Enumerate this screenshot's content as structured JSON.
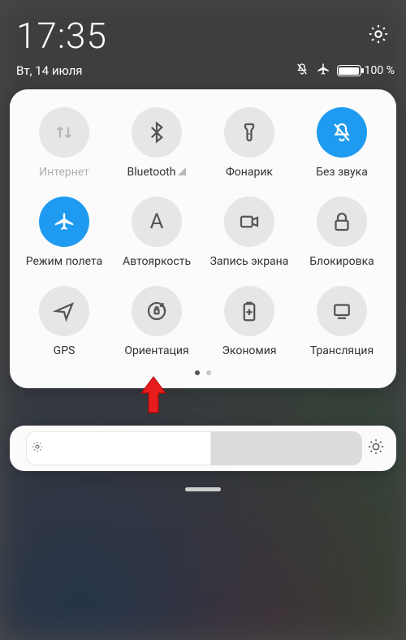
{
  "status": {
    "time": "17:35",
    "date": "Вт, 14 июля",
    "battery_percent": "100 %"
  },
  "tiles": {
    "internet": {
      "label": "Интернет",
      "state": "disabled"
    },
    "bluetooth": {
      "label": "Bluetooth",
      "state": "off"
    },
    "flashlight": {
      "label": "Фонарик",
      "state": "off"
    },
    "mute": {
      "label": "Без звука",
      "state": "on"
    },
    "airplane": {
      "label": "Режим полета",
      "state": "on"
    },
    "autobright": {
      "label": "Автояркость",
      "state": "off"
    },
    "screenrec": {
      "label": "Запись экрана",
      "state": "off"
    },
    "lock": {
      "label": "Блокировка",
      "state": "off"
    },
    "gps": {
      "label": "GPS",
      "state": "off"
    },
    "orientation": {
      "label": "Ориентация",
      "state": "off"
    },
    "battery": {
      "label": "Экономия",
      "state": "off"
    },
    "cast": {
      "label": "Трансляция",
      "state": "off"
    }
  },
  "pager": {
    "pages": 2,
    "active": 0
  },
  "brightness": {
    "level_pct": 55
  },
  "annotation": {
    "pointer_target": "orientation"
  }
}
